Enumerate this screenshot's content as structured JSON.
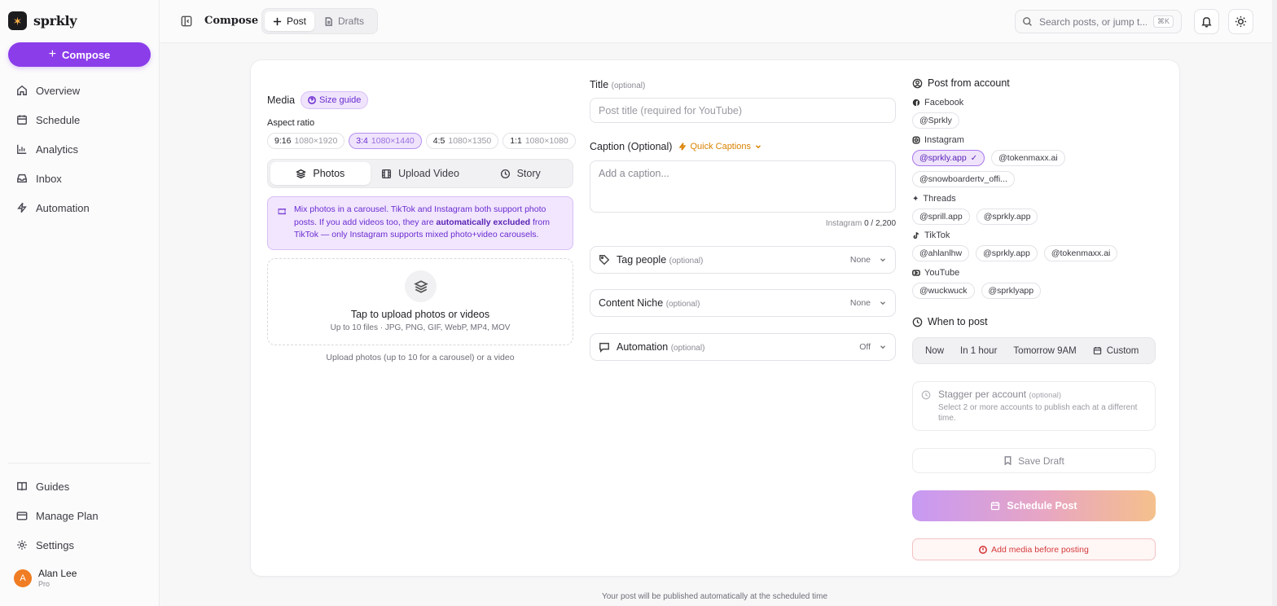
{
  "brand": {
    "name": "sprkly",
    "logo_glyph": "✶"
  },
  "sidebar": {
    "compose_label": "Compose",
    "items": [
      {
        "label": "Overview",
        "icon": "home-icon"
      },
      {
        "label": "Schedule",
        "icon": "calendar-icon"
      },
      {
        "label": "Analytics",
        "icon": "bar-chart-icon"
      },
      {
        "label": "Inbox",
        "icon": "inbox-icon"
      },
      {
        "label": "Automation",
        "icon": "bolt-icon"
      }
    ],
    "bottom_items": [
      {
        "label": "Guides",
        "icon": "book-icon"
      },
      {
        "label": "Manage Plan",
        "icon": "wallet-icon"
      },
      {
        "label": "Settings",
        "icon": "gear-icon"
      }
    ],
    "user": {
      "initial": "A",
      "name": "Alan Lee",
      "plan": "Pro"
    }
  },
  "header": {
    "title": "Compose",
    "tabs": [
      {
        "label": "Post"
      },
      {
        "label": "Drafts"
      }
    ],
    "search_placeholder": "Search posts, or jump t...",
    "search_shortcut": "⌘K"
  },
  "media": {
    "label": "Media",
    "size_guide": "Size guide",
    "aspect_label": "Aspect ratio",
    "aspects": [
      {
        "ratio": "9:16",
        "dims": "1080×1920"
      },
      {
        "ratio": "3:4",
        "dims": "1080×1440"
      },
      {
        "ratio": "4:5",
        "dims": "1080×1350"
      },
      {
        "ratio": "1:1",
        "dims": "1080×1080"
      }
    ],
    "tabs": [
      {
        "label": "Photos"
      },
      {
        "label": "Upload Video"
      },
      {
        "label": "Story"
      }
    ],
    "info_emoji": "🎞",
    "info_1": "Mix photos in a carousel. TikTok and Instagram both support photo posts. If you add videos too, they are ",
    "info_bold": "automatically excluded",
    "info_2": " from TikTok — only Instagram supports mixed photo+video carousels.",
    "upload_title": "Tap to upload photos or videos",
    "upload_sub": "Up to 10 files · JPG, PNG, GIF, WebP, MP4, MOV",
    "upload_hint": "Upload photos (up to 10 for a carousel) or a video"
  },
  "post": {
    "title_label": "Title",
    "title_optional": "(optional)",
    "title_placeholder": "Post title (required for YouTube)",
    "caption_label": "Caption (Optional)",
    "quick_captions": "Quick Captions",
    "caption_placeholder": "Add a caption...",
    "counter_platform": "Instagram",
    "counter_value": "0 / 2,200",
    "options": [
      {
        "label": "Tag people",
        "optional": "(optional)",
        "value": "None"
      },
      {
        "label": "Content Niche",
        "optional": "(optional)",
        "value": "None"
      },
      {
        "label": "Automation",
        "optional": "(optional)",
        "value": "Off"
      }
    ]
  },
  "accounts": {
    "title": "Post from account",
    "platforms": [
      {
        "name": "Facebook",
        "accounts": [
          "@Sprkly"
        ]
      },
      {
        "name": "Instagram",
        "accounts": [
          "@sprkly.app",
          "@tokenmaxx.ai",
          "@snowboardertv_offi..."
        ]
      },
      {
        "name": "Threads",
        "accounts": [
          "@sprill.app",
          "@sprkly.app"
        ]
      },
      {
        "name": "TikTok",
        "accounts": [
          "@ahlanlhw",
          "@sprkly.app",
          "@tokenmaxx.ai"
        ]
      },
      {
        "name": "YouTube",
        "accounts": [
          "@wuckwuck",
          "@sprklyapp"
        ]
      }
    ]
  },
  "schedule": {
    "title": "When to post",
    "options": [
      "Now",
      "In 1 hour",
      "Tomorrow 9AM",
      "Custom"
    ],
    "stagger_title": "Stagger per account",
    "stagger_optional": "(optional)",
    "stagger_desc": "Select 2 or more accounts to publish each at a different time.",
    "save_draft": "Save Draft",
    "schedule_button": "Schedule Post",
    "warning": "Add media before posting"
  },
  "footer": {
    "note": "Your post will be published automatically at the scheduled time"
  },
  "colors": {
    "accent": "#8b3dea",
    "warning": "#d53a3a",
    "quick_captions": "#d98200"
  }
}
